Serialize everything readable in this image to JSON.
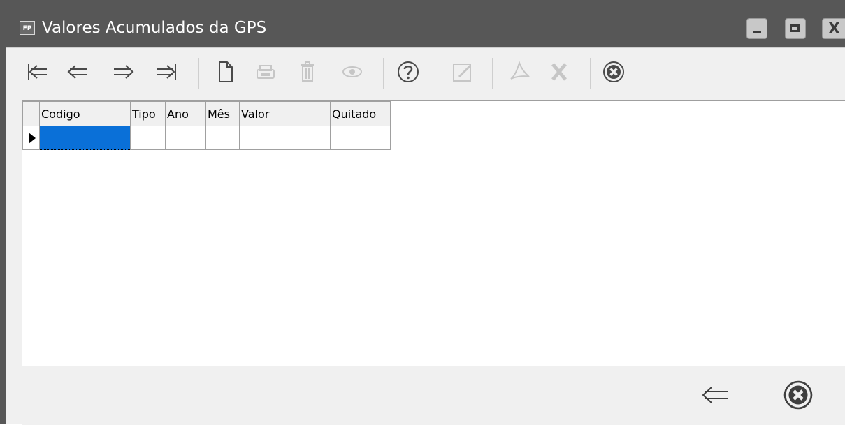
{
  "window": {
    "title": "Valores Acumulados da GPS",
    "app_icon_text": "FP",
    "close_glyph": "X"
  },
  "toolbar": {
    "buttons": [
      {
        "name": "first-record",
        "icon": "first-record-icon",
        "enabled": true
      },
      {
        "name": "previous-record",
        "icon": "previous-record-icon",
        "enabled": true
      },
      {
        "name": "next-record",
        "icon": "next-record-icon",
        "enabled": true
      },
      {
        "name": "last-record",
        "icon": "last-record-icon",
        "enabled": true
      },
      {
        "name": "new-record",
        "icon": "new-document-icon",
        "enabled": true
      },
      {
        "name": "print",
        "icon": "printer-icon",
        "enabled": false
      },
      {
        "name": "delete",
        "icon": "trash-icon",
        "enabled": false
      },
      {
        "name": "view",
        "icon": "eye-icon",
        "enabled": false
      },
      {
        "name": "help",
        "icon": "help-icon",
        "enabled": true
      },
      {
        "name": "edit",
        "icon": "edit-icon",
        "enabled": false
      },
      {
        "name": "export-pdf",
        "icon": "pdf-icon",
        "enabled": false
      },
      {
        "name": "export-excel",
        "icon": "excel-icon",
        "enabled": false
      },
      {
        "name": "close",
        "icon": "close-circle-icon",
        "enabled": true
      }
    ]
  },
  "grid": {
    "columns": [
      "Codigo",
      "Tipo",
      "Ano",
      "Mês",
      "Valor",
      "Quitado"
    ],
    "rows": [
      [
        "",
        "",
        "",
        "",
        "",
        ""
      ]
    ],
    "selection_color": "#0a70d8"
  },
  "footer": {
    "buttons": [
      {
        "name": "back",
        "icon": "back-arrow-icon"
      },
      {
        "name": "close",
        "icon": "close-circle-icon"
      }
    ]
  },
  "colors": {
    "titlebar": "#575757",
    "panel": "#f0f0f0",
    "icon": "#4a4a4a",
    "icon_disabled": "#c6c6c6"
  }
}
